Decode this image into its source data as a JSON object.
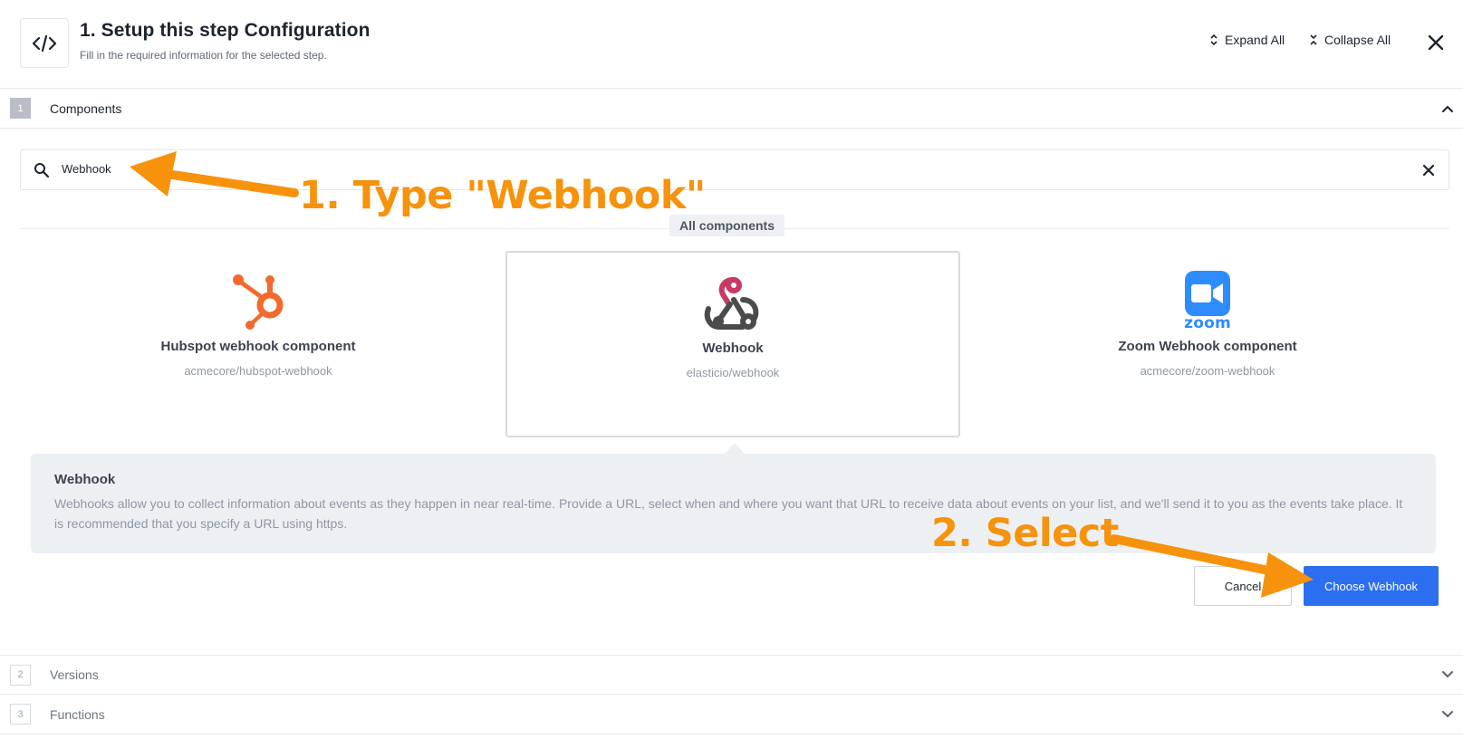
{
  "header": {
    "title": "1. Setup this step Configuration",
    "subtitle": "Fill in the required information for the selected step.",
    "expand_all": "Expand All",
    "collapse_all": "Collapse All"
  },
  "sections": [
    {
      "number": "1",
      "label": "Components",
      "expanded": true
    },
    {
      "number": "2",
      "label": "Versions",
      "expanded": false
    },
    {
      "number": "3",
      "label": "Functions",
      "expanded": false
    }
  ],
  "search": {
    "value": "Webhook"
  },
  "all_components_label": "All components",
  "components": [
    {
      "title": "Hubspot webhook component",
      "path": "acmecore/hubspot-webhook",
      "icon": "hubspot-logo",
      "selected": false
    },
    {
      "title": "Webhook",
      "path": "elasticio/webhook",
      "icon": "webhook-logo",
      "selected": true
    },
    {
      "title": "Zoom Webhook component",
      "path": "acmecore/zoom-webhook",
      "icon": "zoom-logo",
      "selected": false
    }
  ],
  "zoom_wordmark": "zoom",
  "description": {
    "title": "Webhook",
    "text": "Webhooks allow you to collect information about events as they happen in near real-time. Provide a URL, select when and where you want that URL to receive data about events on your list, and we'll send it to you as the events take place. It is recommended that you specify a URL using https."
  },
  "buttons": {
    "cancel": "Cancel",
    "choose": "Choose Webhook"
  },
  "annotations": {
    "step1": "1. Type \"Webhook\"",
    "step2": "2. Select"
  },
  "colors": {
    "primary": "#2b6ff0",
    "annotation": "#f7920c",
    "hubspot": "#f26a2e",
    "zoom": "#2d8cff",
    "webhook_red": "#c73a63",
    "webhook_dark": "#4b4b4b"
  }
}
